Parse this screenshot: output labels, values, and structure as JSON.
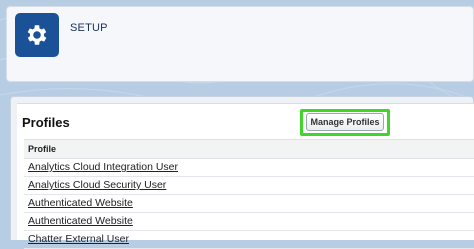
{
  "header": {
    "title": "SETUP",
    "icon": "gear-icon"
  },
  "panel": {
    "title": "Profiles",
    "manage_button_label": "Manage Profiles",
    "column_header": "Profile",
    "rows": [
      "Analytics Cloud Integration User",
      "Analytics Cloud Security User",
      "Authenticated Website",
      "Authenticated Website",
      "Chatter External User"
    ]
  },
  "colors": {
    "background": "#b7cde3",
    "setup_tile": "#1b5297",
    "highlight": "#3fd52b"
  }
}
